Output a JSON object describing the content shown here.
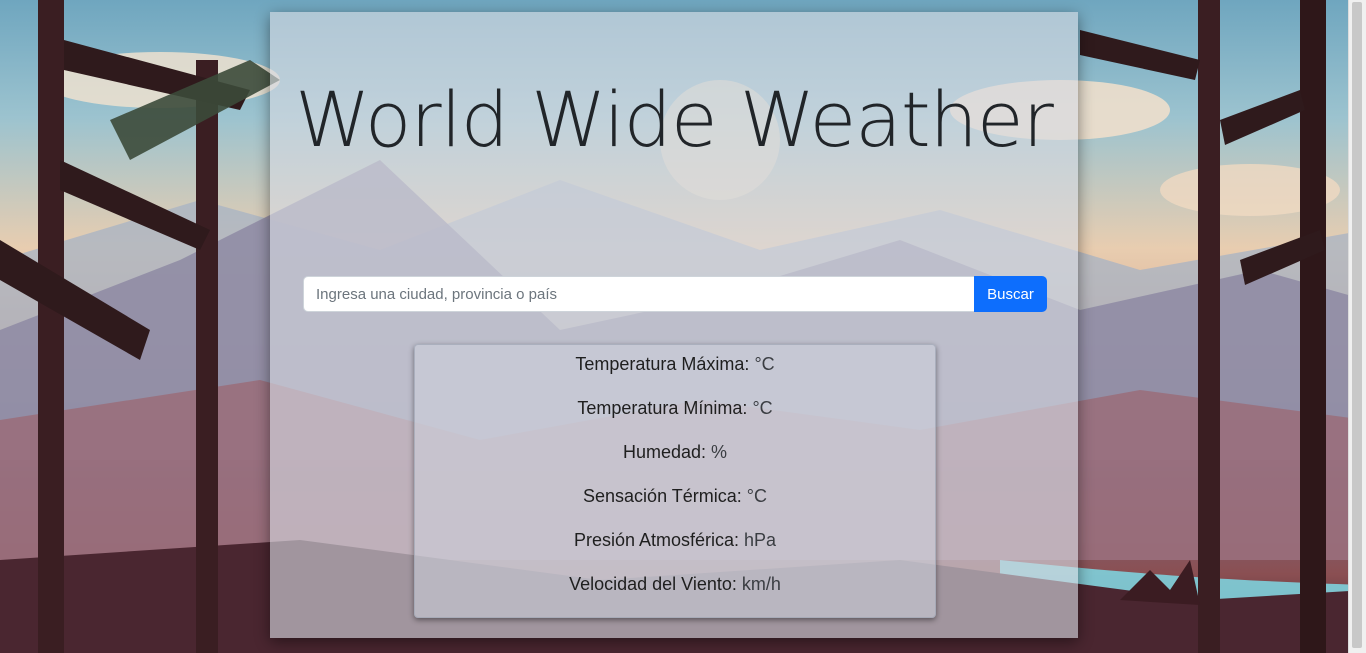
{
  "app": {
    "title": "World Wide Weather"
  },
  "search": {
    "placeholder": "Ingresa una ciudad, provincia o país",
    "value": "",
    "button_label": "Buscar",
    "button_color": "#0d6efd"
  },
  "results": [
    {
      "label": "Temperatura Máxima:",
      "unit": "°C"
    },
    {
      "label": "Temperatura Mínima:",
      "unit": "°C"
    },
    {
      "label": "Humedad:",
      "unit": "%"
    },
    {
      "label": "Sensación Térmica:",
      "unit": "°C"
    },
    {
      "label": "Presión Atmosférica:",
      "unit": "hPa"
    },
    {
      "label": "Velocidad del Viento:",
      "unit": "km/h"
    }
  ],
  "background": {
    "description_icon": "forest-landscape-illustration"
  }
}
